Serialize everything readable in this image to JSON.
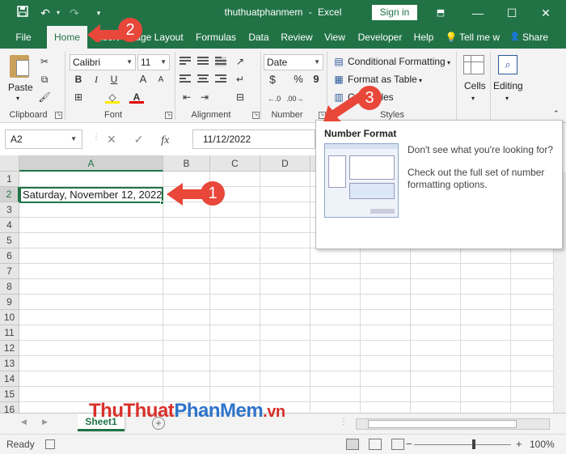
{
  "title_bar": {
    "doc_name": "thuthuatphanmem",
    "separator": "-",
    "app_name": "Excel",
    "sign_in": "Sign in",
    "icons": [
      "save-icon",
      "undo-icon",
      "redo-icon",
      "customize-icon",
      "ribbon-display-icon",
      "minimize-icon",
      "maximize-icon",
      "close-icon"
    ]
  },
  "ribbon_tabs": [
    "File",
    "Home",
    "Insert",
    "Page Layout",
    "Formulas",
    "Data",
    "Review",
    "View",
    "Developer",
    "Help",
    "Tell me w",
    "Share"
  ],
  "ribbon": {
    "clipboard": {
      "label": "Clipboard",
      "paste": "Paste"
    },
    "font": {
      "label": "Font",
      "font_name": "Calibri",
      "font_size": "11",
      "bold": "B",
      "italic": "I",
      "underline": "U",
      "grow": "A",
      "shrink": "A"
    },
    "alignment": {
      "label": "Alignment"
    },
    "number": {
      "label": "Number",
      "format": "Date",
      "currency": "$",
      "percent": "%",
      "comma": "9"
    },
    "styles": {
      "label": "Styles",
      "conditional": "Conditional Formatting",
      "table": "Format as Table",
      "cell_styles": "Cell Styles"
    },
    "cells": {
      "label": "Cells"
    },
    "editing": {
      "label": "Editing"
    }
  },
  "formula_bar": {
    "name_box": "A2",
    "cancel": "✕",
    "enter": "✓",
    "fx": "fx",
    "value": "11/12/2022"
  },
  "grid": {
    "columns": [
      "A",
      "B",
      "C",
      "D"
    ],
    "rows": [
      "1",
      "2",
      "3",
      "4",
      "5",
      "6",
      "7",
      "8",
      "9",
      "10",
      "11",
      "12",
      "13",
      "14",
      "15",
      "16"
    ],
    "selected_cell": "A2",
    "cell_a2": "Saturday, November 12, 2022"
  },
  "tooltip": {
    "title": "Number Format",
    "text1": "Don't see what you're looking for?",
    "text2": "Check out the full set of number formatting options."
  },
  "sheet_tabs": {
    "active": "Sheet1",
    "add": "+"
  },
  "status_bar": {
    "ready": "Ready",
    "zoom": "100%",
    "zoom_out": "−",
    "zoom_in": "+"
  },
  "annotations": [
    "1",
    "2",
    "3"
  ],
  "watermark": {
    "part1": "ThuThuat",
    "part2": "PhanMem",
    "part3": ".vn"
  },
  "colors": {
    "excel_green": "#217346",
    "annotation_red": "#e8473a",
    "ribbon_bg": "#f3f3f3"
  }
}
